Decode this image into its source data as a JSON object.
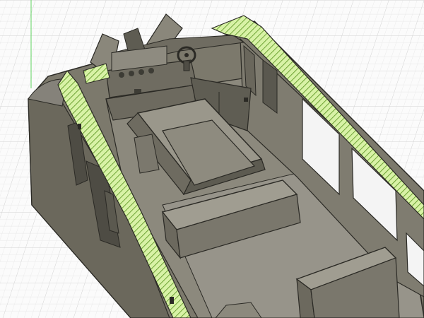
{
  "viewport": {
    "background": "#fbfbfb",
    "grid": {
      "minor_color": "#e4e4e4",
      "major_color": "#cfcfcf",
      "visible": true
    },
    "axis_color": "#5fd35f"
  },
  "model": {
    "section_fill": "#d8f2a6",
    "section_hatch": "#6ea335",
    "body_color": "#7c796c",
    "body_dark": "#5d5b51",
    "body_light": "#99968a",
    "edge_color": "#2b2a25",
    "parts": [
      "hull-shell",
      "section-cut",
      "windshield-frame",
      "dashboard",
      "steering-wheel",
      "engine-cover",
      "side-bench",
      "rear-bench",
      "floor",
      "side-windows"
    ]
  }
}
